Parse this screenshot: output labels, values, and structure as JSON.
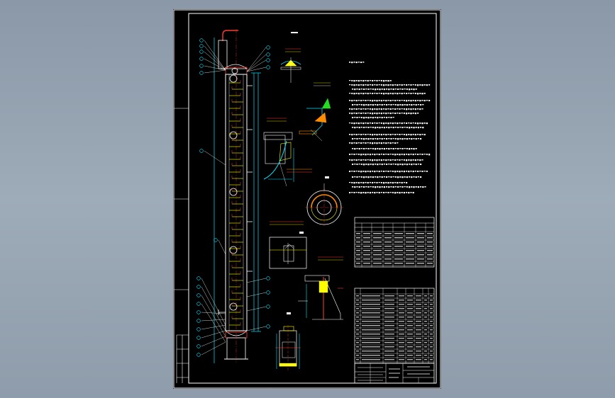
{
  "drawing": {
    "title_block_name": "",
    "view_labels": [],
    "notes": []
  },
  "colors": {
    "viewport_bg": "#8f9cab",
    "sheet_bg": "#000000",
    "frame": "#ffffff",
    "column": "#ffffff",
    "cyan": "#00e5ff",
    "yellow": "#ffff00",
    "red": "#ff3b2f",
    "orange": "#ff8c00",
    "green": "#22dd22",
    "magenta": "#ff40ff"
  }
}
